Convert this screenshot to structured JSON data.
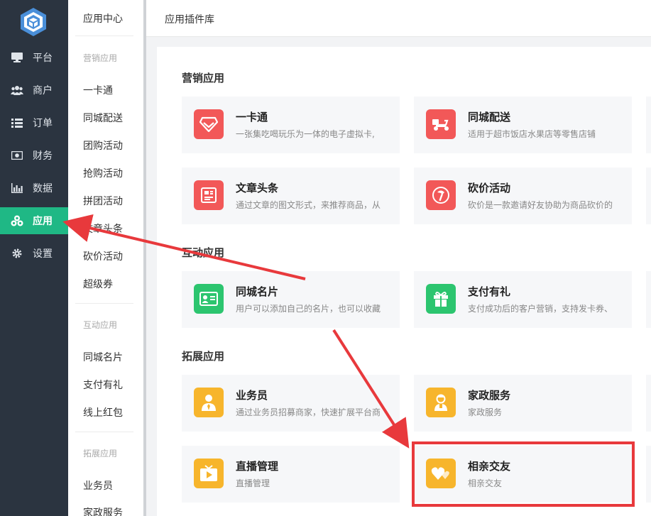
{
  "nav": {
    "items": [
      {
        "label": "平台",
        "icon": "monitor-icon"
      },
      {
        "label": "商户",
        "icon": "users-icon"
      },
      {
        "label": "订单",
        "icon": "list-icon"
      },
      {
        "label": "财务",
        "icon": "money-icon"
      },
      {
        "label": "数据",
        "icon": "bar-chart-icon"
      },
      {
        "label": "应用",
        "icon": "apps-icon"
      },
      {
        "label": "设置",
        "icon": "gear-icon"
      }
    ],
    "active": "应用"
  },
  "submenu": {
    "title": "应用中心",
    "groups": [
      {
        "label": "营销应用",
        "items": [
          "一卡通",
          "同城配送",
          "团购活动",
          "抢购活动",
          "拼团活动",
          "文章头条",
          "砍价活动",
          "超级券"
        ]
      },
      {
        "label": "互动应用",
        "items": [
          "同城名片",
          "支付有礼",
          "线上红包"
        ]
      },
      {
        "label": "拓展应用",
        "items": [
          "业务员",
          "家政服务"
        ]
      }
    ]
  },
  "header": {
    "title": "应用插件库"
  },
  "sections": [
    {
      "title": "营销应用",
      "cards": [
        {
          "name": "一卡通",
          "desc": "一张集吃喝玩乐为一体的电子虚拟卡,",
          "icon": "gem-icon",
          "color": "#f25858"
        },
        {
          "name": "同城配送",
          "desc": "适用于超市饭店水果店等零售店铺",
          "icon": "scooter-icon",
          "color": "#f25858"
        },
        {
          "name": "文章头条",
          "desc": "通过文章的图文形式，来推荐商品，从",
          "icon": "article-icon",
          "color": "#f25858"
        },
        {
          "name": "砍价活动",
          "desc": "砍价是一款邀请好友协助为商品砍价的",
          "icon": "axe-icon",
          "color": "#f25858"
        }
      ]
    },
    {
      "title": "互动应用",
      "cards": [
        {
          "name": "同城名片",
          "desc": "用户可以添加自己的名片，也可以收藏",
          "icon": "id-card-icon",
          "color": "#2cc56f"
        },
        {
          "name": "支付有礼",
          "desc": "支付成功后的客户营销，支持发卡券、",
          "icon": "gift-icon",
          "color": "#2cc56f"
        }
      ]
    },
    {
      "title": "拓展应用",
      "cards": [
        {
          "name": "业务员",
          "desc": "通过业务员招募商家，快速扩展平台商",
          "icon": "salesman-icon",
          "color": "#f7b52c"
        },
        {
          "name": "家政服务",
          "desc": "家政服务",
          "icon": "housekeeper-icon",
          "color": "#f7b52c"
        },
        {
          "name": "直播管理",
          "desc": "直播管理",
          "icon": "tv-icon",
          "color": "#f7b52c"
        },
        {
          "name": "相亲交友",
          "desc": "相亲交友",
          "icon": "hearts-icon",
          "color": "#f7b52c"
        }
      ]
    }
  ],
  "colors": {
    "nav_bg": "#2b3440",
    "accent": "#1fb885",
    "annotation": "#e8393c"
  }
}
